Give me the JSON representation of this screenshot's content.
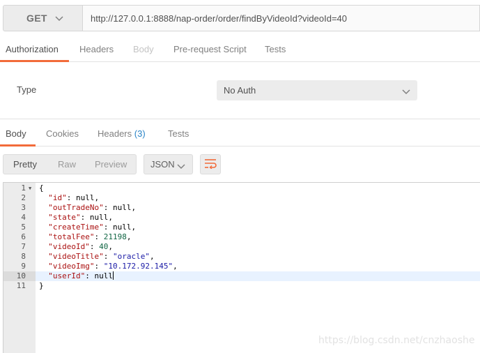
{
  "request": {
    "method": "GET",
    "url": "http://127.0.0.1:8888/nap-order/order/findByVideoId?videoId=40"
  },
  "request_tabs": {
    "authorization": "Authorization",
    "headers": "Headers",
    "body": "Body",
    "prerequest": "Pre-request Script",
    "tests": "Tests"
  },
  "auth": {
    "type_label": "Type",
    "type_value": "No Auth"
  },
  "response_tabs": {
    "body": "Body",
    "cookies": "Cookies",
    "headers": "Headers",
    "headers_count": "(3)",
    "tests": "Tests"
  },
  "toolbar": {
    "pretty": "Pretty",
    "raw": "Raw",
    "preview": "Preview",
    "format": "JSON"
  },
  "editor": {
    "current_line": 10,
    "lines": [
      {
        "n": "1",
        "text": "{"
      },
      {
        "n": "2",
        "key": "\"id\"",
        "value": "null",
        "vtype": "lit"
      },
      {
        "n": "3",
        "key": "\"outTradeNo\"",
        "value": "null",
        "vtype": "lit"
      },
      {
        "n": "4",
        "key": "\"state\"",
        "value": "null",
        "vtype": "lit"
      },
      {
        "n": "5",
        "key": "\"createTime\"",
        "value": "null",
        "vtype": "lit"
      },
      {
        "n": "6",
        "key": "\"totalFee\"",
        "value": "21198",
        "vtype": "num"
      },
      {
        "n": "7",
        "key": "\"videoId\"",
        "value": "40",
        "vtype": "num"
      },
      {
        "n": "8",
        "key": "\"videoTitle\"",
        "value": "\"oracle\"",
        "vtype": "str"
      },
      {
        "n": "9",
        "key": "\"videoImg\"",
        "value": "\"10.172.92.145\"",
        "vtype": "str"
      },
      {
        "n": "10",
        "key": "\"userId\"",
        "value": "null",
        "vtype": "lit",
        "last": true
      },
      {
        "n": "11",
        "text": "}"
      }
    ]
  },
  "watermark": "https://blog.csdn.net/cnzhaoshe",
  "colors": {
    "accent": "#f26b3a",
    "link": "#2a84c7"
  },
  "icons": {
    "method_dropdown": "chevron-down-icon",
    "auth_dropdown": "chevron-down-icon",
    "format_dropdown": "chevron-down-icon",
    "wrap": "wrap-lines-icon",
    "fold": "fold-arrow-icon"
  }
}
